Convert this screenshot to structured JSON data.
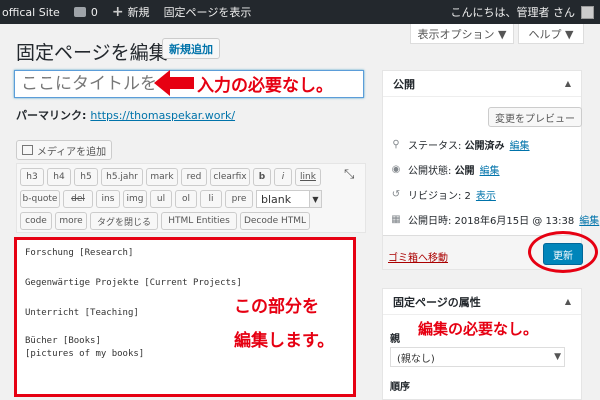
{
  "adminbar": {
    "site_name": "offical Site",
    "comments_count": "0",
    "new_label": "新規",
    "view_page": "固定ページを表示",
    "greeting": "こんにちは、管理者 さん"
  },
  "screen_options": "表示オプション ▼",
  "help": "ヘルプ ▼",
  "page_title": "固定ページを編集",
  "add_new": "新規追加",
  "title_input": {
    "value": "ここにタイトルを"
  },
  "annotation_title": "入力の必要なし。",
  "permalink": {
    "label": "パーマリンク:",
    "url": "https://thomaspekar.work/"
  },
  "media_button": "メディアを追加",
  "toolbar": {
    "row1": [
      "h3",
      "h4",
      "h5",
      "h5.jahr",
      "mark",
      "red",
      "clearfix",
      "b",
      "i",
      "link"
    ],
    "row2": [
      "b-quote",
      "del",
      "ins",
      "img",
      "ul",
      "ol",
      "li",
      "pre"
    ],
    "select_value": "blank",
    "row3": [
      "code",
      "more",
      "タグを閉じる",
      "HTML Entities",
      "Decode HTML"
    ]
  },
  "editor_lines": [
    "Forschung [Research]",
    "Gegenwärtige Projekte [Current Projects]",
    "Unterricht [Teaching]",
    "Bücher [Books]",
    "[pictures of my books]"
  ],
  "annotation_editor": [
    "この部分を",
    "編集します。"
  ],
  "publish": {
    "title": "公開",
    "preview_button": "変更をプレビュー",
    "status_label": "ステータス:",
    "status_value": "公開済み",
    "visibility_label": "公開状態:",
    "visibility_value": "公開",
    "revisions_label": "リビジョン: 2",
    "revisions_link": "表示",
    "published_on": "公開日時: 2018年6月15日 @ 13:38",
    "edit_link": "編集",
    "trash": "ゴミ箱へ移動",
    "update": "更新"
  },
  "attributes": {
    "title": "固定ページの属性",
    "parent_label": "親",
    "parent_value": "(親なし)",
    "order_label": "順序"
  },
  "annotation_attributes": "編集の必要なし。",
  "colors": {
    "annotation_red": "#e60012",
    "wp_blue": "#0085ba",
    "adminbar": "#23282d"
  }
}
